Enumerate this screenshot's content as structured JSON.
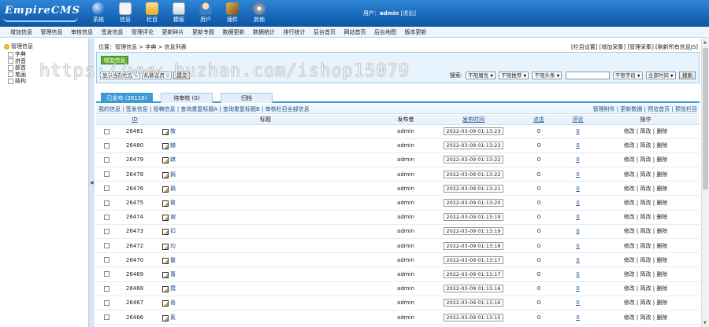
{
  "header": {
    "logo": "EmpireCMS",
    "nav": [
      {
        "label": "系统",
        "icon": "globe-icon"
      },
      {
        "label": "信息",
        "icon": "document-icon"
      },
      {
        "label": "栏目",
        "icon": "folder-icon"
      },
      {
        "label": "模板",
        "icon": "template-icon"
      },
      {
        "label": "用户",
        "icon": "user-icon"
      },
      {
        "label": "插件",
        "icon": "tools-icon"
      },
      {
        "label": "其他",
        "icon": "gear-icon"
      }
    ],
    "user_prefix": "用户：",
    "user_name": "admin",
    "logout": "[退出]"
  },
  "submenu": [
    "增加信息",
    "管理信息",
    "审核信息",
    "签发信息",
    "管理评论",
    "更新碎片",
    "更新专题",
    "数据更新",
    "数据统计",
    "排行统计",
    "后台首页",
    "网站首页",
    "后台地图",
    "版本更新"
  ],
  "sidebar": {
    "root": "管理信息",
    "items": [
      "字典",
      "拼音",
      "部首",
      "笔画",
      "结构"
    ]
  },
  "breadcrumb": "位置：管理信息 > 字典 > 信息列表",
  "crumb_links": "[栏目设置] [增加采集] [管理采集] [刷新所有信息JS]",
  "panel": {
    "add_button": "增加信息",
    "scope_select": "显示当前栏目",
    "order_select": "刷新首页",
    "go_button": "提交",
    "search_label": "搜索:",
    "attr_select": "不限属性",
    "recommend_select": "不限推荐",
    "headline_select": "不限头条",
    "field_select": "不限字段",
    "time_select": "全部时间",
    "search_button": "搜索"
  },
  "tabs": [
    {
      "label": "已发布 (26118)",
      "active": true
    },
    {
      "label": "待审核 (0)",
      "active": false
    },
    {
      "label": "归档",
      "active": false
    }
  ],
  "list_toolbar": {
    "left": "我的信息 | 签发信息 | 投稿信息 | 查询重复标题A | 查询重复标题B | 审核栏目全部信息",
    "right": "管理附件 | 更新数据 | 预览首页 | 预览栏目"
  },
  "table": {
    "headers": {
      "id": "ID",
      "title": "标题",
      "publisher": "发布者",
      "time": "发布时间",
      "clicks": "点击",
      "comments": "评论",
      "ops": "操作"
    },
    "ops": [
      "修改",
      "简改",
      "删除"
    ],
    "rows": [
      {
        "id": "26481",
        "title": "敬",
        "publisher": "admin",
        "time": "2022-03-09 01:13:23",
        "clicks": "0",
        "comments": "0"
      },
      {
        "id": "26480",
        "title": "棘",
        "publisher": "admin",
        "time": "2022-03-09 01:13:23",
        "clicks": "0",
        "comments": "0"
      },
      {
        "id": "26479",
        "title": "蹠",
        "publisher": "admin",
        "time": "2022-03-09 01:13:22",
        "clicks": "0",
        "comments": "0"
      },
      {
        "id": "26478",
        "title": "摘",
        "publisher": "admin",
        "time": "2022-03-09 01:13:22",
        "clicks": "0",
        "comments": "0"
      },
      {
        "id": "26476",
        "title": "摘",
        "publisher": "admin",
        "time": "2022-03-09 01:13:21",
        "clicks": "0",
        "comments": "0"
      },
      {
        "id": "26475",
        "title": "敢",
        "publisher": "admin",
        "time": "2022-03-09 01:13:20",
        "clicks": "0",
        "comments": "0"
      },
      {
        "id": "26474",
        "title": "谢",
        "publisher": "admin",
        "time": "2022-03-09 01:13:19",
        "clicks": "0",
        "comments": "0"
      },
      {
        "id": "26473",
        "title": "扣",
        "publisher": "admin",
        "time": "2022-03-09 01:13:19",
        "clicks": "0",
        "comments": "0"
      },
      {
        "id": "26472",
        "title": "均",
        "publisher": "admin",
        "time": "2022-03-09 01:13:18",
        "clicks": "0",
        "comments": "0"
      },
      {
        "id": "26470",
        "title": "鬣",
        "publisher": "admin",
        "time": "2022-03-09 01:13:17",
        "clicks": "0",
        "comments": "0"
      },
      {
        "id": "26469",
        "title": "蓍",
        "publisher": "admin",
        "time": "2022-03-09 01:13:17",
        "clicks": "0",
        "comments": "0"
      },
      {
        "id": "26468",
        "title": "摸",
        "publisher": "admin",
        "time": "2022-03-09 01:13:16",
        "clicks": "0",
        "comments": "0"
      },
      {
        "id": "26467",
        "title": "善",
        "publisher": "admin",
        "time": "2022-03-09 01:13:16",
        "clicks": "0",
        "comments": "0"
      },
      {
        "id": "26466",
        "title": "蕉",
        "publisher": "admin",
        "time": "2022-03-09 01:13:15",
        "clicks": "0",
        "comments": "0"
      }
    ]
  },
  "watermark": "https://www.huzhan.com/ishop15079"
}
